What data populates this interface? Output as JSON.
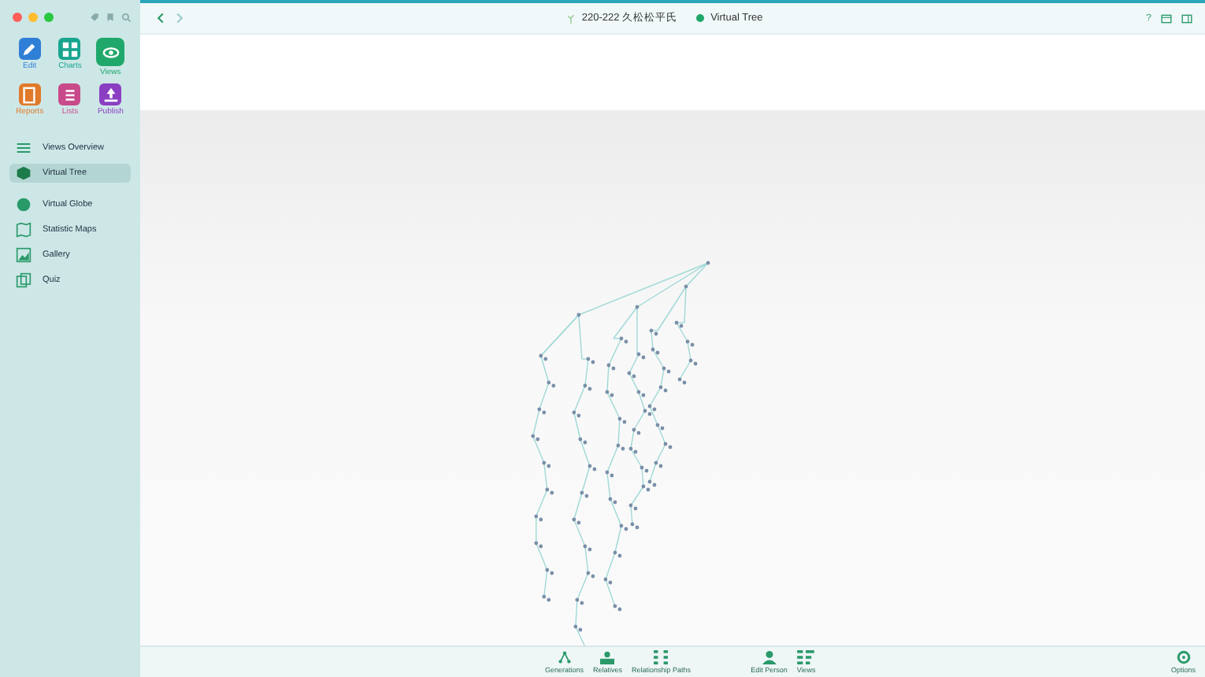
{
  "sidebar": {
    "tools": [
      {
        "label": "Edit",
        "kind": "edit",
        "selected": false
      },
      {
        "label": "Charts",
        "kind": "charts",
        "selected": false
      },
      {
        "label": "Views",
        "kind": "views",
        "selected": true
      },
      {
        "label": "Reports",
        "kind": "reports",
        "selected": false
      },
      {
        "label": "Lists",
        "kind": "lists",
        "selected": false
      },
      {
        "label": "Publish",
        "kind": "publish",
        "selected": false
      }
    ],
    "items": [
      {
        "label": "Views Overview",
        "kind": "overview",
        "selected": false
      },
      {
        "label": "Virtual Tree",
        "kind": "tree",
        "selected": true
      },
      {
        "label": "Virtual Globe",
        "kind": "globe",
        "selected": false
      },
      {
        "label": "Statistic Maps",
        "kind": "maps",
        "selected": false
      },
      {
        "label": "Gallery",
        "kind": "gallery",
        "selected": false
      },
      {
        "label": "Quiz",
        "kind": "quiz",
        "selected": false
      }
    ]
  },
  "titlebar": {
    "family": "220-222 久松松平氏",
    "view": "Virtual Tree",
    "help": "?"
  },
  "bottom_bar": {
    "buttons": [
      {
        "label": "Generations",
        "kind": "generations"
      },
      {
        "label": "Relatives",
        "kind": "relatives"
      },
      {
        "label": "Relationship Paths",
        "kind": "paths"
      },
      {
        "label": "Edit Person",
        "kind": "person"
      },
      {
        "label": "Views",
        "kind": "views"
      }
    ],
    "options": "Options"
  }
}
